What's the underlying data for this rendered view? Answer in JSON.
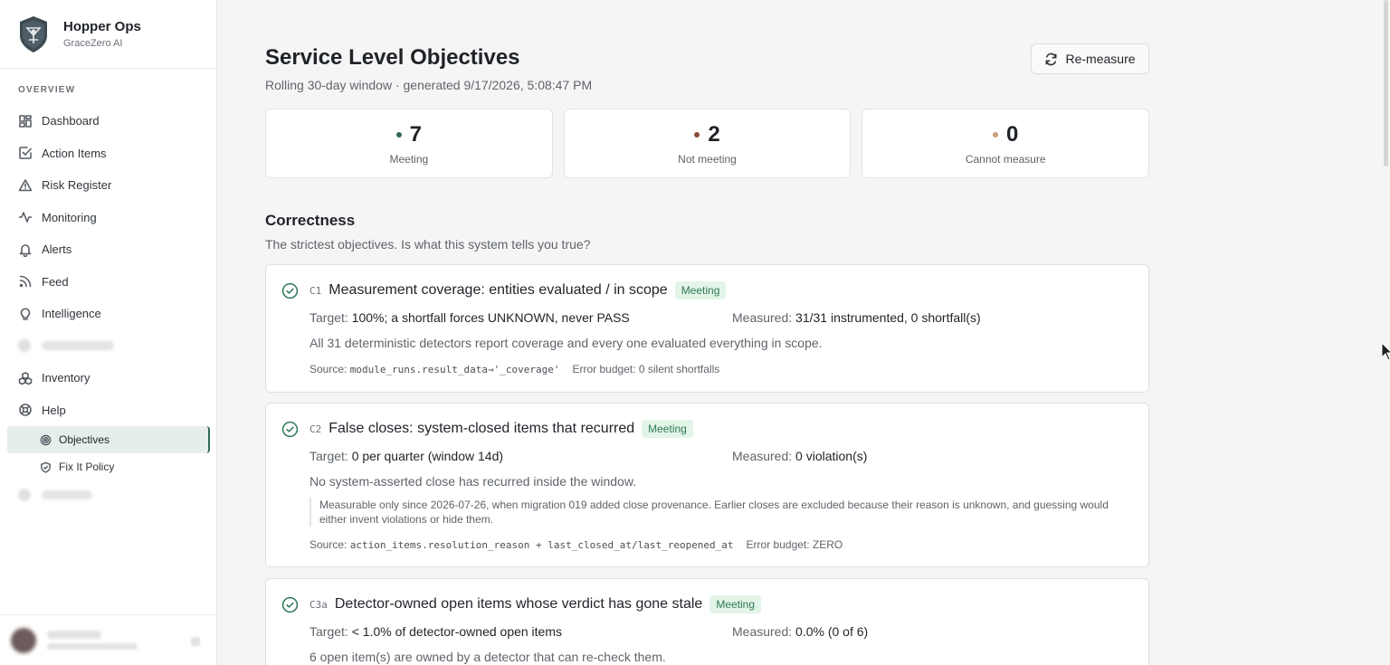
{
  "brand": {
    "name": "Hopper Ops",
    "subtitle": "GraceZero AI"
  },
  "sidebar": {
    "section_label": "OVERVIEW",
    "items": [
      {
        "label": "Dashboard",
        "icon": "grid-icon"
      },
      {
        "label": "Action Items",
        "icon": "checkbox-icon"
      },
      {
        "label": "Risk Register",
        "icon": "warning-icon"
      },
      {
        "label": "Monitoring",
        "icon": "pulse-icon"
      },
      {
        "label": "Alerts",
        "icon": "bell-icon"
      },
      {
        "label": "Feed",
        "icon": "rss-icon"
      },
      {
        "label": "Intelligence",
        "icon": "lightbulb-icon"
      },
      {
        "label": "Inventory",
        "icon": "boxes-icon"
      },
      {
        "label": "Help",
        "icon": "lifebuoy-icon"
      }
    ],
    "sub_items": [
      {
        "label": "Objectives",
        "icon": "target-icon",
        "active": true
      },
      {
        "label": "Fix It Policy",
        "icon": "shield-check-icon",
        "active": false
      }
    ]
  },
  "header": {
    "title": "Service Level Objectives",
    "subtitle": "Rolling 30-day window · generated 9/17/2026, 5:08:47 PM",
    "remeasure_label": "Re-measure"
  },
  "summary": [
    {
      "value": "7",
      "label": "Meeting",
      "color": "#2f6b52"
    },
    {
      "value": "2",
      "label": "Not meeting",
      "color": "#8a4a3a"
    },
    {
      "value": "0",
      "label": "Cannot measure",
      "color": "#c8a07a"
    }
  ],
  "section": {
    "title": "Correctness",
    "description": "The strictest objectives. Is what this system tells you true?"
  },
  "objectives": [
    {
      "code": "C1",
      "title": "Measurement coverage: entities evaluated / in scope",
      "status": "Meeting",
      "target_label": "Target:",
      "target": "100%; a shortfall forces UNKNOWN, never PASS",
      "measured_label": "Measured:",
      "measured": "31/31 instrumented, 0 shortfall(s)",
      "description": "All 31 deterministic detectors report coverage and every one evaluated everything in scope.",
      "source_label": "Source:",
      "source": "module_runs.result_data→'_coverage'",
      "error_budget": "Error budget: 0 silent shortfalls"
    },
    {
      "code": "C2",
      "title": "False closes: system-closed items that recurred",
      "status": "Meeting",
      "target_label": "Target:",
      "target": "0 per quarter (window 14d)",
      "measured_label": "Measured:",
      "measured": "0 violation(s)",
      "description": "No system-asserted close has recurred inside the window.",
      "note": "Measurable only since 2026-07-26, when migration 019 added close provenance. Earlier closes are excluded because their reason is unknown, and guessing would either invent violations or hide them.",
      "source_label": "Source:",
      "source": "action_items.resolution_reason + last_closed_at/last_reopened_at",
      "error_budget": "Error budget: ZERO"
    },
    {
      "code": "C3a",
      "title": "Detector-owned open items whose verdict has gone stale",
      "status": "Meeting",
      "target_label": "Target:",
      "target": "< 1.0% of detector-owned open items",
      "measured_label": "Measured:",
      "measured": "0.0% (0 of 6)",
      "description": "6 open item(s) are owned by a detector that can re-check them."
    }
  ]
}
